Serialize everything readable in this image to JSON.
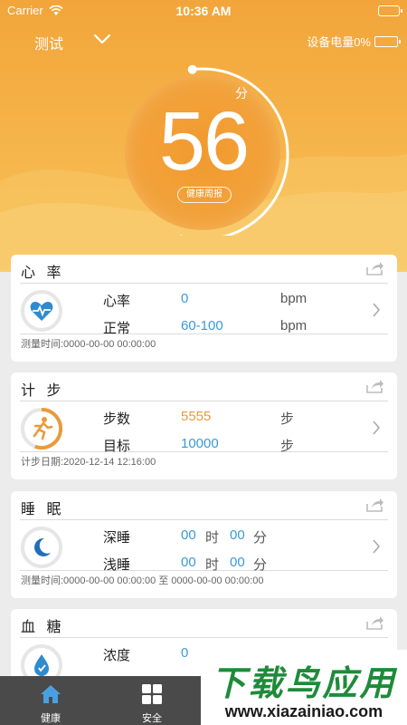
{
  "status": {
    "carrier": "Carrier",
    "time": "10:36 AM"
  },
  "nav": {
    "title": "测试",
    "power_label": "设备电量0%"
  },
  "score": {
    "value": "56",
    "unit": "分",
    "report_label": "健康周报",
    "ring_progress": 0.56
  },
  "colors": {
    "accent_orange": "#f2a53a",
    "value_blue": "#3a9ad9",
    "steps_orange": "#e99b3c",
    "tabbar": "#4a4a4a"
  },
  "cards": {
    "heart": {
      "title": "心 率",
      "rows": [
        {
          "label": "心率",
          "value": "0",
          "unit": "bpm"
        },
        {
          "label": "正常",
          "value": "60-100",
          "unit": "bpm"
        }
      ],
      "footer": "测量时间:0000-00-00 00:00:00",
      "icon": "heart-pulse-icon"
    },
    "steps": {
      "title": "计 步",
      "rows": [
        {
          "label": "步数",
          "value": "5555",
          "unit": "步"
        },
        {
          "label": "目标",
          "value": "10000",
          "unit": "步"
        }
      ],
      "footer": "计步日期:2020-12-14 12:16:00",
      "icon": "runner-icon",
      "progress": 0.5555
    },
    "sleep": {
      "title": "睡 眠",
      "rows": [
        {
          "label": "深睡",
          "h": "00",
          "h_unit": "时",
          "m": "00",
          "m_unit": "分"
        },
        {
          "label": "浅睡",
          "h": "00",
          "h_unit": "时",
          "m": "00",
          "m_unit": "分"
        }
      ],
      "footer": "测量时间:0000-00-00 00:00:00 至 0000-00-00 00:00:00",
      "icon": "moon-icon"
    },
    "glucose": {
      "title": "血 糖",
      "rows": [
        {
          "label": "浓度",
          "value": "0"
        }
      ],
      "icon": "blood-drop-icon"
    }
  },
  "tabs": [
    {
      "label": "健康",
      "icon": "house-icon",
      "active": true
    },
    {
      "label": "安全",
      "icon": "grid-icon",
      "active": false
    }
  ],
  "watermark": {
    "title": "下载鸟应用",
    "url": "www.xiazainiao.com"
  }
}
